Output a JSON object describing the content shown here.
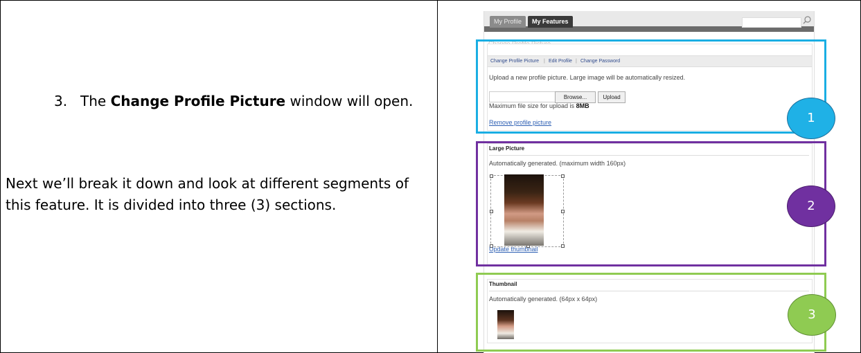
{
  "left": {
    "step_number": "3.",
    "step_prefix": "The",
    "step_bold": "Change Profile Picture",
    "step_suffix": "window will open.",
    "paragraph": "Next we’ll break it down and look at different segments of this feature.  It is divided into three (3) sections."
  },
  "screenshot": {
    "tabs": [
      "My Profile",
      "My Features"
    ],
    "faint_title": "Change Profile Picture",
    "subtabs": [
      "Change Profile Picture",
      "|",
      "Edit Profile",
      "|",
      "Change Password"
    ],
    "upload_text": "Upload a new profile picture. Large image will be automatically resized.",
    "browse_label": "Browse...",
    "upload_label": "Upload",
    "max_size_prefix": "Maximum file size for upload is",
    "max_size_value": "8MB",
    "remove_link": "Remove profile picture",
    "large_title": "Large Picture",
    "large_text": "Automatically generated. (maximum width 160px)",
    "update_link": "Update thumbnail",
    "thumb_title": "Thumbnail",
    "thumb_text": "Automatically generated. (64px x 64px)"
  },
  "badges": [
    "1",
    "2",
    "3"
  ],
  "colors": {
    "section1": "#1aaee3",
    "section2": "#7030a0",
    "section3": "#8fcb52"
  }
}
